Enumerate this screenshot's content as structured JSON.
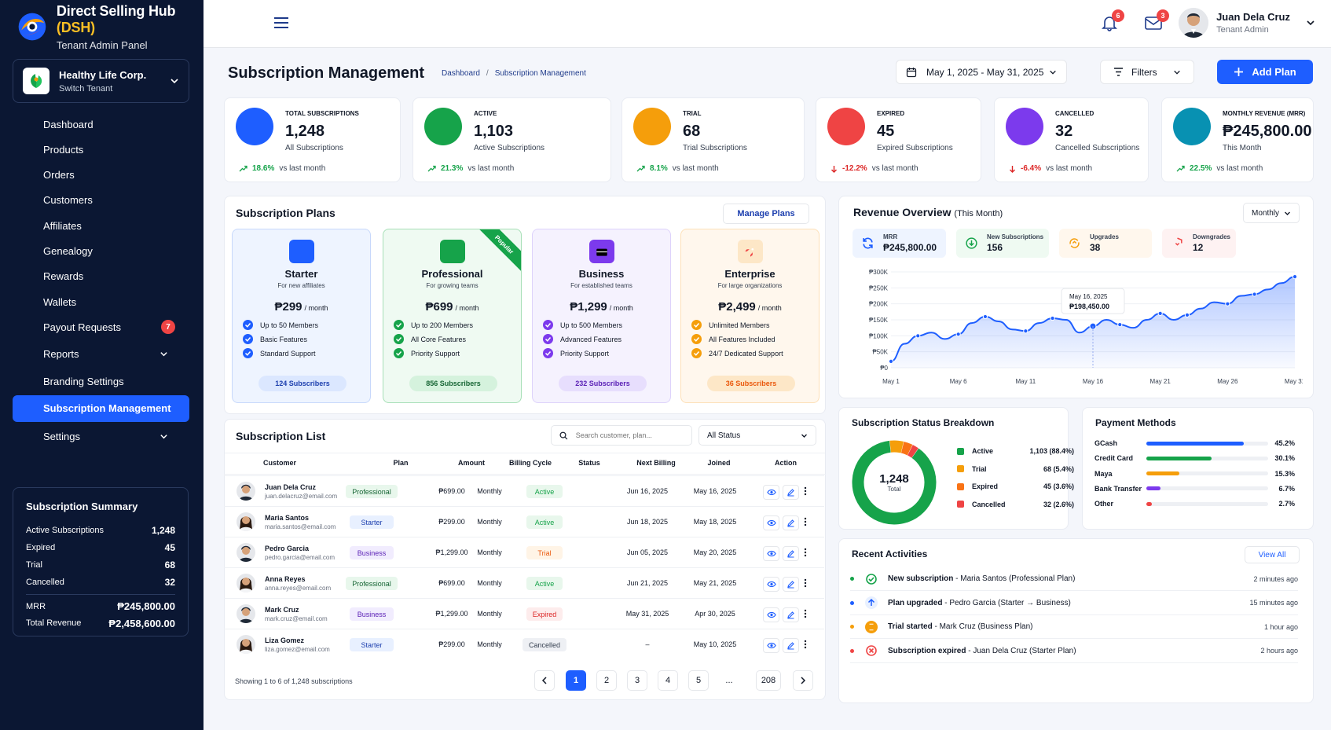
{
  "brand": {
    "title": "Direct Selling Hub",
    "title_hl": "(DSH)",
    "subtitle": "Tenant Admin Panel"
  },
  "tenant": {
    "name": "Healthy Life Corp.",
    "switch_label": "Switch Tenant"
  },
  "nav": [
    {
      "label": "Dashboard",
      "icon": "home-icon"
    },
    {
      "label": "Products",
      "icon": "box-icon"
    },
    {
      "label": "Orders",
      "icon": "clipboard-icon"
    },
    {
      "label": "Customers",
      "icon": "users-icon"
    },
    {
      "label": "Affiliates",
      "icon": "user-icon"
    },
    {
      "label": "Genealogy",
      "icon": "tree-icon"
    },
    {
      "label": "Rewards",
      "icon": "gift-icon"
    },
    {
      "label": "Wallets",
      "icon": "wallet-icon"
    },
    {
      "label": "Payout Requests",
      "icon": "payout-icon",
      "badge": "7"
    },
    {
      "label": "Reports",
      "icon": "reports-icon"
    },
    {
      "label": "Branding Settings",
      "icon": "branding-icon"
    },
    {
      "label": "Subscription Management",
      "icon": "crown-icon"
    },
    {
      "label": "Settings",
      "icon": "gear-icon"
    }
  ],
  "summary": {
    "title": "Subscription Summary",
    "rows": [
      {
        "label": "Active Subscriptions",
        "value": "1,248"
      },
      {
        "label": "Expired",
        "value": "45"
      },
      {
        "label": "Trial",
        "value": "68"
      },
      {
        "label": "Cancelled",
        "value": "32"
      },
      {
        "label": "MRR",
        "value": "₱245,800.00"
      },
      {
        "label": "Total Revenue",
        "value": "₱2,458,600.00"
      }
    ]
  },
  "topbar": {
    "notif_count": "6",
    "mail_count": "3",
    "user_name": "Juan Dela Cruz",
    "user_role": "Tenant Admin"
  },
  "header": {
    "title": "Subscription Management",
    "breadcrumb": [
      "Dashboard",
      "Subscription Management"
    ],
    "date_range": "May 1, 2025 - May 31, 2025",
    "filters_label": "Filters",
    "add_label": "Add Plan"
  },
  "kpis": [
    {
      "label": "TOTAL SUBSCRIPTIONS",
      "value": "1,248",
      "sub": "All Subscriptions",
      "pct": "18.6%",
      "trend": "up",
      "vs": "vs last month",
      "color": "#1e5eff",
      "icon": "crown-icon"
    },
    {
      "label": "ACTIVE",
      "value": "1,103",
      "sub": "Active Subscriptions",
      "pct": "21.3%",
      "trend": "up",
      "vs": "vs last month",
      "color": "#16a34a",
      "icon": "check-circle-icon"
    },
    {
      "label": "TRIAL",
      "value": "68",
      "sub": "Trial Subscriptions",
      "pct": "8.1%",
      "trend": "up",
      "vs": "vs last month",
      "color": "#f59e0b",
      "icon": "hourglass-icon"
    },
    {
      "label": "EXPIRED",
      "value": "45",
      "sub": "Expired Subscriptions",
      "pct": "-12.2%",
      "trend": "down",
      "vs": "vs last month",
      "color": "#ef4444",
      "icon": "x-circle-icon"
    },
    {
      "label": "CANCELLED",
      "value": "32",
      "sub": "Cancelled Subscriptions",
      "pct": "-6.4%",
      "trend": "down",
      "vs": "vs last month",
      "color": "#7c3aed",
      "icon": "refresh-icon"
    },
    {
      "label": "MONTHLY REVENUE (MRR)",
      "value": "₱245,800.00",
      "sub": "This Month",
      "pct": "22.5%",
      "trend": "up",
      "vs": "vs last month",
      "color": "#0891b2",
      "icon": "peso-icon"
    }
  ],
  "plans_panel": {
    "title": "Subscription Plans",
    "manage_label": "Manage Plans"
  },
  "plans": [
    {
      "name": "Starter",
      "desc": "For new affiliates",
      "price": "₱299",
      "per": "/ month",
      "features": [
        "Up to 50 Members",
        "Basic Features",
        "Standard Support"
      ],
      "subscribers": "124 Subscribers",
      "color": "#1e5eff",
      "bg": "#eef4ff",
      "border": "#c7d8fb",
      "pillbg": "#dbe7ff",
      "icon": "diamond-icon"
    },
    {
      "name": "Professional",
      "desc": "For growing teams",
      "price": "₱699",
      "per": "/ month",
      "features": [
        "Up to 200 Members",
        "All Core Features",
        "Priority Support"
      ],
      "subscribers": "856 Subscribers",
      "color": "#16a34a",
      "bg": "#effaf2",
      "border": "#a7dfb7",
      "pillbg": "#d5f2dd",
      "icon": "crown-icon",
      "ribbon": "Popular"
    },
    {
      "name": "Business",
      "desc": "For established teams",
      "price": "₱1,299",
      "per": "/ month",
      "features": [
        "Up to 500 Members",
        "Advanced Features",
        "Priority Support"
      ],
      "subscribers": "232 Subscribers",
      "color": "#7c3aed",
      "bg": "#f5f2fe",
      "border": "#ddd2fb",
      "pillbg": "#e7defd",
      "icon": "briefcase-icon"
    },
    {
      "name": "Enterprise",
      "desc": "For large organizations",
      "price": "₱2,499",
      "per": "/ month",
      "features": [
        "Unlimited Members",
        "All Features Included",
        "24/7 Dedicated Support"
      ],
      "subscribers": "36 Subscribers",
      "color": "#f59e0b",
      "bg": "#fff7ed",
      "border": "#fde0b8",
      "pillbg": "#fde7c7",
      "icon": "rocket-icon"
    }
  ],
  "revenue": {
    "title": "Revenue Overview",
    "title_suffix": "(This Month)",
    "period": "Monthly",
    "tabs": [
      {
        "label": "MRR",
        "value": "₱245,800.00",
        "color": "#1e5eff",
        "bg": "#eef4ff",
        "icon": "refresh-icon"
      },
      {
        "label": "New Subscriptions",
        "value": "156",
        "color": "#16a34a",
        "bg": "#effaf2",
        "icon": "download-icon"
      },
      {
        "label": "Upgrades",
        "value": "38",
        "color": "#f59e0b",
        "bg": "#fff7ed",
        "icon": "upgrade-icon"
      },
      {
        "label": "Downgrades",
        "value": "12",
        "color": "#ef4444",
        "bg": "#fef2f2",
        "icon": "downgrade-icon"
      }
    ],
    "tooltip": {
      "date": "May 16, 2025",
      "value": "₱198,450.00"
    }
  },
  "chart_data": {
    "type": "area",
    "y_ticks": [
      "₱300K",
      "₱250K",
      "₱200K",
      "₱150K",
      "₱100K",
      "₱50K",
      "₱0"
    ],
    "x_ticks": [
      "May 1",
      "May 6",
      "May 11",
      "May 16",
      "May 21",
      "May 26",
      "May 31"
    ],
    "ylim": [
      0,
      300000
    ],
    "x": [
      1,
      2,
      3,
      4,
      5,
      6,
      7,
      8,
      9,
      10,
      11,
      12,
      13,
      14,
      15,
      16,
      17,
      18,
      19,
      20,
      21,
      22,
      23,
      24,
      25,
      26,
      27,
      28,
      29,
      30,
      31
    ],
    "values": [
      20000,
      75000,
      100000,
      110000,
      90000,
      105000,
      140000,
      160000,
      145000,
      120000,
      115000,
      140000,
      155000,
      150000,
      110000,
      130000,
      150000,
      135000,
      125000,
      150000,
      170000,
      150000,
      165000,
      185000,
      205000,
      200000,
      225000,
      230000,
      245000,
      265000,
      285000
    ]
  },
  "subscription_list": {
    "title": "Subscription List",
    "search_placeholder": "Search customer, plan...",
    "status_filter": "All Status",
    "columns": [
      "Customer",
      "Plan",
      "Amount",
      "Billing Cycle",
      "Status",
      "Next Billing",
      "Joined",
      "Action"
    ],
    "rows": [
      {
        "name": "Juan Dela Cruz",
        "email": "juan.delacruz@email.com",
        "plan": "Professional",
        "amount": "₱699.00",
        "cycle": "Monthly",
        "status": "Active",
        "next": "Jun 16, 2025",
        "joined": "May 16, 2025",
        "gender": "m"
      },
      {
        "name": "Maria Santos",
        "email": "maria.santos@email.com",
        "plan": "Starter",
        "amount": "₱299.00",
        "cycle": "Monthly",
        "status": "Active",
        "next": "Jun 18, 2025",
        "joined": "May 18, 2025",
        "gender": "f"
      },
      {
        "name": "Pedro Garcia",
        "email": "pedro.garcia@email.com",
        "plan": "Business",
        "amount": "₱1,299.00",
        "cycle": "Monthly",
        "status": "Trial",
        "next": "Jun 05, 2025",
        "joined": "May 20, 2025",
        "gender": "m"
      },
      {
        "name": "Anna Reyes",
        "email": "anna.reyes@email.com",
        "plan": "Professional",
        "amount": "₱699.00",
        "cycle": "Monthly",
        "status": "Active",
        "next": "Jun 21, 2025",
        "joined": "May 21, 2025",
        "gender": "f"
      },
      {
        "name": "Mark Cruz",
        "email": "mark.cruz@email.com",
        "plan": "Business",
        "amount": "₱1,299.00",
        "cycle": "Monthly",
        "status": "Expired",
        "next": "May 31, 2025",
        "joined": "Apr 30, 2025",
        "gender": "m"
      },
      {
        "name": "Liza Gomez",
        "email": "liza.gomez@email.com",
        "plan": "Starter",
        "amount": "₱299.00",
        "cycle": "Monthly",
        "status": "Cancelled",
        "next": "–",
        "joined": "May 10, 2025",
        "gender": "f"
      }
    ],
    "showing": "Showing 1 to 6 of 1,248 subscriptions",
    "pages": [
      "1",
      "2",
      "3",
      "4",
      "5",
      "...",
      "208"
    ]
  },
  "status_breakdown": {
    "title": "Subscription Status Breakdown",
    "total": "1,248",
    "total_label": "Total",
    "items": [
      {
        "label": "Active",
        "count": "1,103 (88.4%)",
        "pct": 88.4,
        "color": "#16a34a"
      },
      {
        "label": "Trial",
        "count": "68 (5.4%)",
        "pct": 5.4,
        "color": "#f59e0b"
      },
      {
        "label": "Expired",
        "count": "45 (3.6%)",
        "pct": 3.6,
        "color": "#f97316"
      },
      {
        "label": "Cancelled",
        "count": "32 (2.6%)",
        "pct": 2.6,
        "color": "#ef4444"
      }
    ]
  },
  "payment_methods": {
    "title": "Payment Methods",
    "items": [
      {
        "label": "GCash",
        "pct": "45.2%",
        "value": 45.2,
        "color": "#1e5eff"
      },
      {
        "label": "Credit Card",
        "pct": "30.1%",
        "value": 30.1,
        "color": "#16a34a"
      },
      {
        "label": "Maya",
        "pct": "15.3%",
        "value": 15.3,
        "color": "#f59e0b"
      },
      {
        "label": "Bank Transfer",
        "pct": "6.7%",
        "value": 6.7,
        "color": "#7c3aed"
      },
      {
        "label": "Other",
        "pct": "2.7%",
        "value": 2.7,
        "color": "#ef4444"
      }
    ]
  },
  "activities": {
    "title": "Recent Activities",
    "view_all": "View All",
    "items": [
      {
        "bold": "New subscription",
        "rest": " - Maria Santos (Professional Plan)",
        "time": "2 minutes ago",
        "color": "#16a34a"
      },
      {
        "bold": "Plan upgraded",
        "rest": " - Pedro Garcia (Starter → Business)",
        "time": "15 minutes ago",
        "color": "#1e5eff"
      },
      {
        "bold": "Trial started",
        "rest": " - Mark Cruz (Business Plan)",
        "time": "1 hour ago",
        "color": "#f59e0b"
      },
      {
        "bold": "Subscription expired",
        "rest": " - Juan Dela Cruz (Starter Plan)",
        "time": "2 hours ago",
        "color": "#ef4444"
      }
    ]
  }
}
